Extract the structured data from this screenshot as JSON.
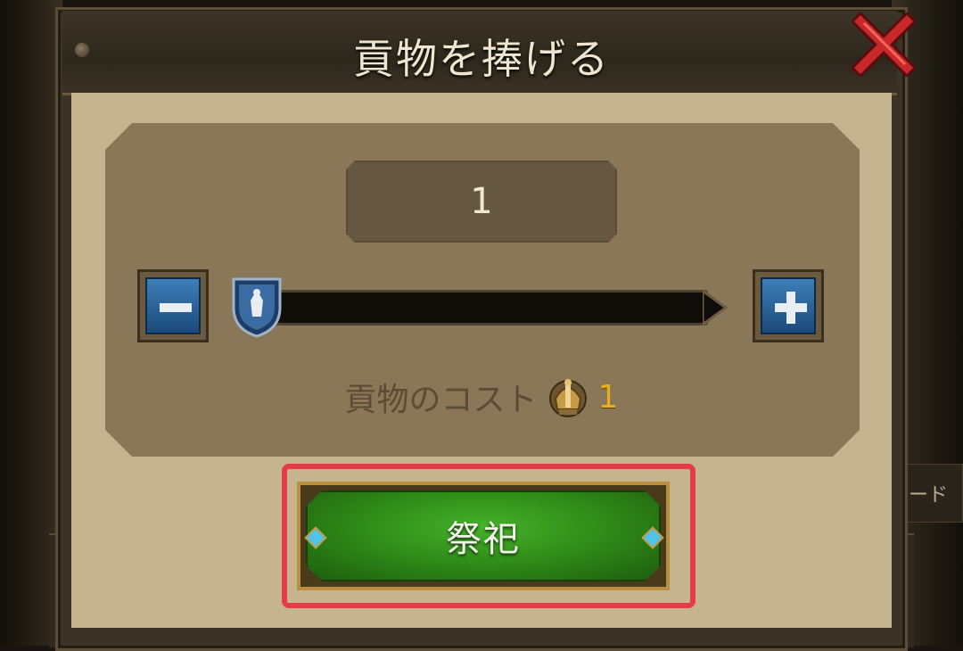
{
  "dialog": {
    "title": "貢物を捧げる",
    "close_icon": "close-x-icon"
  },
  "quantity": {
    "value": "1",
    "minus_icon": "minus-icon",
    "plus_icon": "plus-icon",
    "slider_fraction": 0
  },
  "cost": {
    "label": "貢物のコスト",
    "icon": "tribute-helmet-icon",
    "value": "1"
  },
  "action": {
    "label": "祭祀"
  },
  "background": {
    "side_tab_text": "ード"
  },
  "colors": {
    "highlight": "#e23c48",
    "cost_value": "#e6b022",
    "button_green": "#2f8a18",
    "stepper_blue": "#2a66a0"
  }
}
